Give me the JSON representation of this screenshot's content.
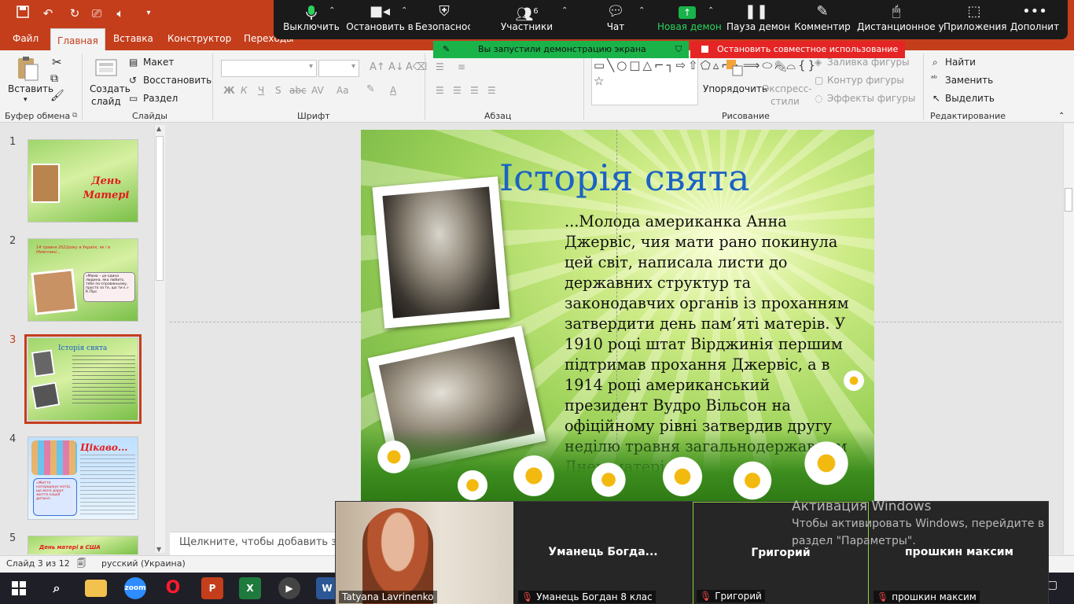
{
  "quick_access": {
    "save_icon": "save-icon",
    "undo_icon": "undo-icon",
    "redo_icon": "redo-icon",
    "present_icon": "present-icon",
    "audio_icon": "speaker-icon",
    "customize_icon": "chevron-down-icon"
  },
  "tabs": [
    "Файл",
    "Главная",
    "Вставка",
    "Конструктор",
    "Переходы"
  ],
  "active_tab": "Главная",
  "ribbon": {
    "clipboard": {
      "paste": "Вставить",
      "label": "Буфер обмена"
    },
    "slides": {
      "new_slide": "Создать",
      "new_slide2": "слайд",
      "layout": "Макет",
      "reset": "Восстановить",
      "section": "Раздел",
      "label": "Слайды"
    },
    "font": {
      "label": "Шрифт",
      "bold": "Ж",
      "italic": "К",
      "underline": "Ч",
      "strike": "S",
      "abc": "abc",
      "shadow": "S",
      "aa": "Aa"
    },
    "paragraph": {
      "label": "Абзац"
    },
    "drawing": {
      "arrange": "Упорядочить",
      "quick_styles": "Экспресс-",
      "quick_styles2": "стили",
      "fill": "Заливка фигуры",
      "outline": "Контур фигуры",
      "effects": "Эффекты фигуры",
      "label": "Рисование"
    },
    "editing": {
      "find": "Найти",
      "replace": "Заменить",
      "select": "Выделить",
      "label": "Редактирование"
    }
  },
  "zoom": {
    "mute": "Выключить",
    "stop_video": "Остановить в",
    "security": "Безопасность",
    "participants": "Участники",
    "participants_count": "6",
    "chat": "Чат",
    "new_share": "Новая демон",
    "pause_share": "Пауза демон",
    "annotate": "Комментир",
    "remote": "Дистанционное у",
    "apps": "Приложения",
    "more": "Дополнит"
  },
  "share_banner": {
    "text": "Вы запустили демонстрацию экрана",
    "stop": "Остановить совместное использование"
  },
  "thumbnails": [
    {
      "num": "1",
      "title": "День Матері"
    },
    {
      "num": "2",
      "text": "14 травня 2022року в Україні, як і в Німеччині...",
      "quote": "«Мама – це єдина людина, яка любить тебе по-справжньому, просто за те, що ти є.» К.Пірс"
    },
    {
      "num": "3",
      "title": "Історія свята"
    },
    {
      "num": "4",
      "title": "Цікаво...",
      "quote": "«Життя нагороджує матір, що вона дарує життя нашій дитині»"
    },
    {
      "num": "5",
      "title": "День матері в США"
    }
  ],
  "slide": {
    "title": "Історія свята",
    "body": "...Молода американка Анна Джервіс, чия мати рано покинула цей світ, написала листи до державних структур та законодавчих органів із проханням затвердити день пам’яті матерів. У 1910 році штат Вірджинія першим підтримав прохання Джервіс, а в 1914 році американський президент Вудро Вільсон на офіційному рівні затвердив другу неділю травня загальнодержавним Днем матері."
  },
  "notes_placeholder": "Щелкните, чтобы добавить за",
  "status": {
    "slide_of": "Слайд 3 из 12",
    "language": "русский (Украина)"
  },
  "videos": [
    {
      "label": "Tatyana Lavrinenko"
    },
    {
      "name": "Уманець  Богда...",
      "label": "Уманець Богдан 8 клас"
    },
    {
      "name": "Григорий",
      "label": "Григорий"
    },
    {
      "name": "прошкин максим",
      "label": "прошкин максим"
    }
  ],
  "windows_activation": {
    "title": "Активация Windows",
    "line1": "Чтобы активировать Windows, перейдите в",
    "line2": "раздел \"Параметры\"."
  },
  "taskbar": {
    "zoom_label": "zoom"
  },
  "colors": {
    "accent": "#c43e1c",
    "zoom_green": "#19b34a",
    "zoom_red": "#e52525",
    "title_blue": "#1b63c4"
  }
}
